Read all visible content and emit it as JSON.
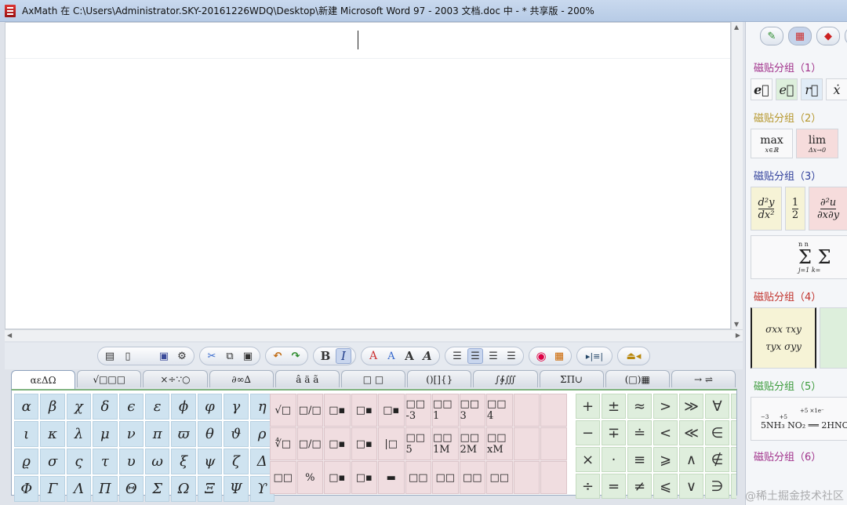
{
  "window": {
    "title": "AxMath 在 C:\\Users\\Administrator.SKY-20161226WDQ\\Desktop\\新建 Microsoft Word 97 - 2003 文档.doc 中 - * 共享版 - 200%"
  },
  "toolbar": {
    "groups": [
      {
        "name": "file-group",
        "buttons": [
          {
            "name": "new-icon",
            "glyph": "▤"
          },
          {
            "name": "blank-doc-icon",
            "glyph": "▯"
          },
          {
            "name": "empty-slot",
            "glyph": ""
          },
          {
            "name": "save-icon",
            "glyph": "💾"
          },
          {
            "name": "settings-icon",
            "glyph": "⚙"
          }
        ]
      },
      {
        "name": "clipboard-group",
        "buttons": [
          {
            "name": "cut-icon",
            "glyph": "✂"
          },
          {
            "name": "copy-icon",
            "glyph": "⧉"
          },
          {
            "name": "paste-icon",
            "glyph": "📋"
          }
        ]
      },
      {
        "name": "history-group",
        "buttons": [
          {
            "name": "undo-icon",
            "glyph": "↶"
          },
          {
            "name": "redo-icon",
            "glyph": "↷"
          }
        ]
      },
      {
        "name": "style-group",
        "buttons": [
          {
            "name": "bold-button",
            "glyph": "B"
          },
          {
            "name": "italic-button",
            "glyph": "I"
          }
        ]
      },
      {
        "name": "fontsize-group",
        "buttons": [
          {
            "name": "font-a1-icon",
            "glyph": "ᴬA"
          },
          {
            "name": "font-a2-icon",
            "glyph": "ᴬA"
          },
          {
            "name": "font-a3-icon",
            "glyph": "ᴬA"
          },
          {
            "name": "font-a4-icon",
            "glyph": "ᴬA"
          }
        ]
      },
      {
        "name": "align-group",
        "buttons": [
          {
            "name": "align-left-icon",
            "glyph": "☰"
          },
          {
            "name": "align-center-icon",
            "glyph": "☰"
          },
          {
            "name": "align-right-icon",
            "glyph": "☰"
          },
          {
            "name": "align-justify-icon",
            "glyph": "☰"
          }
        ]
      },
      {
        "name": "color-group",
        "buttons": [
          {
            "name": "color-wheel-icon",
            "glyph": "◉"
          },
          {
            "name": "color-grid-icon",
            "glyph": "▦"
          }
        ]
      },
      {
        "name": "matrix-group",
        "buttons": [
          {
            "name": "matrix-insert-icon",
            "glyph": "▸|≡|"
          }
        ]
      },
      {
        "name": "export-group",
        "buttons": [
          {
            "name": "stamp-icon",
            "glyph": "⏏"
          }
        ]
      }
    ]
  },
  "tabs": [
    "αεΔΩ",
    "√□□□",
    "×÷∵○",
    "∂∞∆",
    "â ä ã",
    "□ □",
    "()[]{}",
    "∫∲∭",
    "ΣΠ∪",
    "(□)▦",
    "→ ⇌"
  ],
  "greek": [
    "α",
    "β",
    "χ",
    "δ",
    "ϵ",
    "ε",
    "ϕ",
    "φ",
    "γ",
    "η",
    "ι",
    "κ",
    "λ",
    "μ",
    "ν",
    "π",
    "ϖ",
    "θ",
    "ϑ",
    "ρ",
    "ϱ",
    "σ",
    "ς",
    "τ",
    "υ",
    "ω",
    "ξ",
    "ψ",
    "ζ",
    "Δ",
    "Φ",
    "Γ",
    "Λ",
    "Π",
    "Θ",
    "Σ",
    "Ω",
    "Ξ",
    "Ψ",
    "ϒ"
  ],
  "templates": [
    "√□",
    "□/□",
    "□▪",
    "□▪",
    "□▪",
    "□□ -3",
    "□□ 1",
    "□□ 3",
    "□□ 4",
    "",
    "",
    "∜□",
    "□/□",
    "□▪",
    "□▪",
    "|□",
    "□□ 5",
    "□□ 1M",
    "□□ 2M",
    "□□ xM",
    "",
    "",
    "□□",
    "%",
    "□▪",
    "□▪",
    "▬",
    "□□",
    "□□",
    "□□",
    "□□",
    "",
    ""
  ],
  "operators": [
    "+",
    "±",
    "≈",
    ">",
    "≫",
    "∀",
    "›",
    "−",
    "∓",
    "≐",
    "<",
    "≪",
    "∈",
    "−",
    "×",
    "·",
    "≡",
    "⩾",
    "∧",
    "∉",
    "−",
    "÷",
    "=",
    "≠",
    "⩽",
    "∨",
    "∋",
    "−"
  ],
  "tile_pane": {
    "tool_icons": [
      "brush-icon",
      "palette-icon",
      "eraser-icon"
    ],
    "groups": [
      {
        "label": "磁贴分组（1）",
        "color": "#a0308a"
      },
      {
        "label": "磁贴分组（2）",
        "color": "#b5962a"
      },
      {
        "label": "磁贴分组（3）",
        "color": "#2d3d9a"
      },
      {
        "label": "磁贴分组（4）",
        "color": "#c0302a"
      },
      {
        "label": "磁贴分组（5）",
        "color": "#3a9a3a"
      },
      {
        "label": "磁贴分组（6）",
        "color": "#a0308a"
      }
    ],
    "g1_tiles": [
      "e⃗",
      "e⃗",
      "r⃗",
      "ẋ"
    ],
    "g2_tiles": [
      {
        "top": "max",
        "sub": "x∈ℝ"
      },
      {
        "top": "lim",
        "sub": "Δx→0"
      }
    ],
    "g3_tiles": [
      {
        "num": "d²y",
        "den": "dx²"
      },
      {
        "num": "1",
        "den": "2"
      },
      {
        "num": "∂²u",
        "den": "∂x∂y"
      }
    ],
    "g3_sum": {
      "glyph": "Σ Σ",
      "sub": "j=1  k=",
      "sup": "n   n"
    },
    "g4_tiles": [
      {
        "r1": "σxx  τxy",
        "r2": "τyx  σyy"
      }
    ],
    "g5_tile": {
      "text": "5NH₃ NO₂ ══ 2HNO",
      "over": "+5 ×1e⁻",
      "left": "−3",
      "right": "+5"
    }
  },
  "watermark": "@稀土掘金技术社区"
}
